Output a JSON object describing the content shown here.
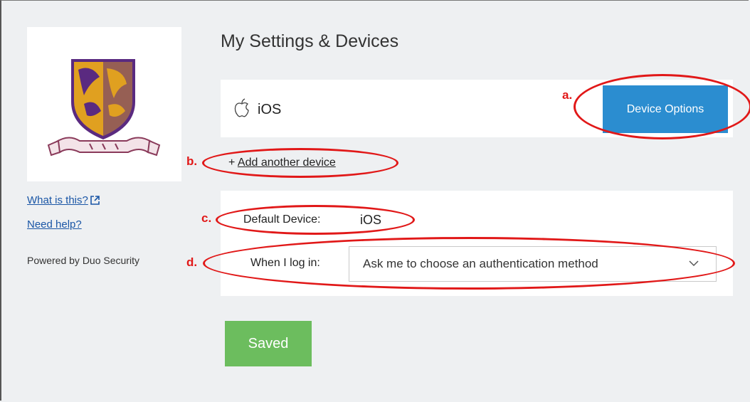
{
  "page": {
    "title": "My Settings & Devices"
  },
  "sidebar": {
    "what_is_this": "What is this?",
    "need_help": "Need help?",
    "powered_by": "Powered by Duo Security"
  },
  "device": {
    "icon": "apple-icon",
    "name": "iOS",
    "options_button": "Device Options"
  },
  "add_device": {
    "prefix": "+",
    "label": "Add another device"
  },
  "settings": {
    "default_device_label": "Default Device:",
    "default_device_value": "iOS",
    "login_label": "When I log in:",
    "login_method": "Ask me to choose an authentication method"
  },
  "saved_button": "Saved",
  "annotations": {
    "a": "a.",
    "b": "b.",
    "c": "c.",
    "d": "d.",
    "color": "#e11818"
  },
  "colors": {
    "primary": "#2b8dd0",
    "success": "#6cbd5e",
    "link": "#1a56a6",
    "crest_purple": "#5a2a80",
    "crest_gold": "#e0a020"
  }
}
